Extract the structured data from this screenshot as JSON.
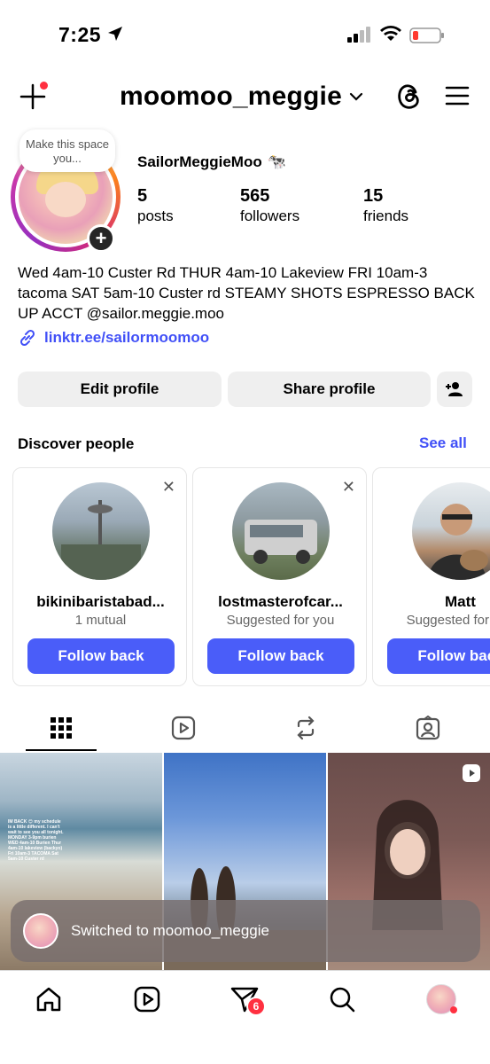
{
  "status_bar": {
    "time": "7:25"
  },
  "header": {
    "username": "moomoo_meggie"
  },
  "profile": {
    "note": "Make this space you...",
    "display_name": "SailorMeggieMoo",
    "display_emoji": "🐄",
    "stats": [
      {
        "value": "5",
        "label": "posts"
      },
      {
        "value": "565",
        "label": "followers"
      },
      {
        "value": "15",
        "label": "friends"
      }
    ],
    "bio": "Wed 4am-10 Custer Rd THUR 4am-10 Lakeview FRI 10am-3 tacoma SAT 5am-10 Custer rd STEAMY SHOTS ESPRESSO BACK UP ACCT @sailor.meggie.moo",
    "link": "linktr.ee/sailormoomoo",
    "edit_label": "Edit profile",
    "share_label": "Share profile"
  },
  "discover": {
    "title": "Discover people",
    "see_all": "See all",
    "cards": [
      {
        "name": "bikinibaristabad...",
        "sub": "1 mutual",
        "button": "Follow back"
      },
      {
        "name": "lostmasterofcar...",
        "sub": "Suggested for you",
        "button": "Follow back"
      },
      {
        "name": "Matt",
        "sub": "Suggested for you",
        "button": "Follow back"
      }
    ]
  },
  "grid": {
    "tile1_caption": "IM BACK 😍 my schedule is a little different. I can't wait to see you all tonight. MONDAY 3-9pm burien WED 4am-10 Burien Thur 4am-10 lakeview (backyo) Fri 10am-3 TACOMA Sat 5am-10 Custer rd"
  },
  "toast": {
    "text": "Switched to moomoo_meggie"
  },
  "bottom_nav": {
    "badge_count": "6"
  },
  "colors": {
    "accent": "#4a5df9",
    "link": "#4150f7",
    "notification": "#ff3040"
  }
}
